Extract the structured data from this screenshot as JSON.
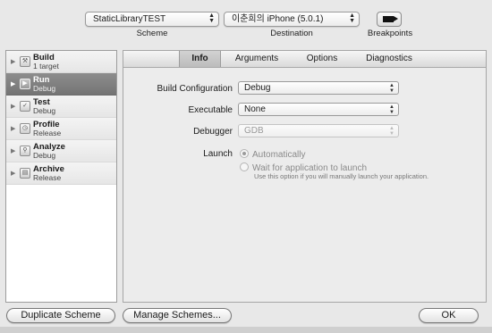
{
  "toolbar": {
    "scheme_value": "StaticLibraryTEST",
    "scheme_label": "Scheme",
    "destination_value": "이춘희의 iPhone (5.0.1)",
    "destination_label": "Destination",
    "breakpoints_label": "Breakpoints",
    "breakpoints_icon": "breakpoint-icon"
  },
  "actions": [
    {
      "name": "Build",
      "sub": "1 target",
      "icon": "build-icon"
    },
    {
      "name": "Run",
      "sub": "Debug",
      "icon": "run-icon"
    },
    {
      "name": "Test",
      "sub": "Debug",
      "icon": "test-icon"
    },
    {
      "name": "Profile",
      "sub": "Release",
      "icon": "profile-icon"
    },
    {
      "name": "Analyze",
      "sub": "Debug",
      "icon": "analyze-icon"
    },
    {
      "name": "Archive",
      "sub": "Release",
      "icon": "archive-icon"
    }
  ],
  "selected_action": "Run",
  "tabs": [
    "Info",
    "Arguments",
    "Options",
    "Diagnostics"
  ],
  "active_tab": "Info",
  "info": {
    "build_configuration_label": "Build Configuration",
    "build_configuration_value": "Debug",
    "executable_label": "Executable",
    "executable_value": "None",
    "debugger_label": "Debugger",
    "debugger_value": "GDB",
    "launch_label": "Launch",
    "launch_auto": "Automatically",
    "launch_wait": "Wait for application to launch",
    "launch_hint": "Use this option if you will manually launch your application."
  },
  "buttons": {
    "duplicate": "Duplicate Scheme",
    "manage": "Manage Schemes...",
    "ok": "OK"
  }
}
